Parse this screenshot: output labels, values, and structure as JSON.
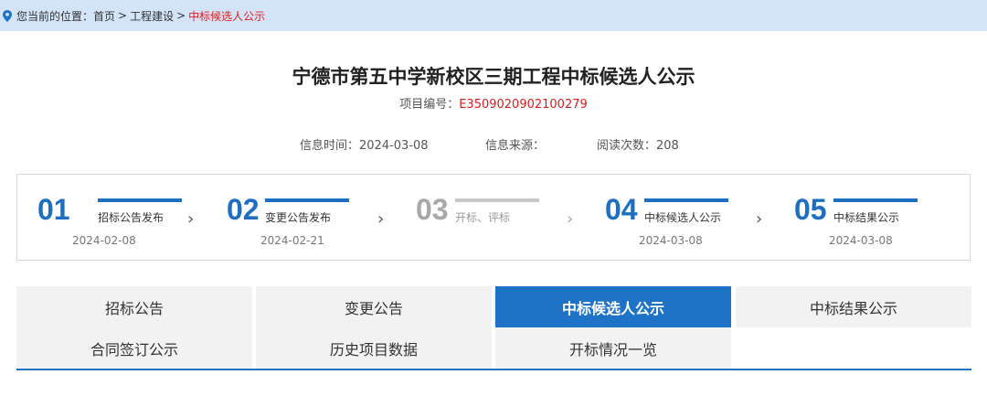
{
  "breadcrumb": {
    "prefix": "您当前的位置：",
    "items": [
      "首页",
      "工程建设"
    ],
    "separator": ">",
    "current": "中标候选人公示"
  },
  "title": "宁德市第五中学新校区三期工程中标候选人公示",
  "project_code": {
    "label": "项目编号：",
    "value": "E3509020902100279"
  },
  "meta": {
    "time": "信息时间：2024-03-08",
    "source": "信息来源：",
    "views": "阅读次数：208"
  },
  "steps": [
    {
      "num": "01",
      "label": "招标公告发布",
      "date": "2024-02-08",
      "state": "done"
    },
    {
      "num": "02",
      "label": "变更公告发布",
      "date": "2024-02-21",
      "state": "done"
    },
    {
      "num": "03",
      "label": "开标、评标",
      "date": "",
      "state": "inactive"
    },
    {
      "num": "04",
      "label": "中标候选人公示",
      "date": "2024-03-08",
      "state": "done"
    },
    {
      "num": "05",
      "label": "中标结果公示",
      "date": "2024-03-08",
      "state": "done"
    }
  ],
  "chevron": "›",
  "tabs": [
    {
      "label": "招标公告",
      "active": false
    },
    {
      "label": "变更公告",
      "active": false
    },
    {
      "label": "中标候选人公示",
      "active": true
    },
    {
      "label": "中标结果公示",
      "active": false
    },
    {
      "label": "合同签订公示",
      "active": false
    },
    {
      "label": "历史项目数据",
      "active": false
    },
    {
      "label": "开标情况一览",
      "active": false
    }
  ],
  "colors": {
    "accent": "#1f73c6",
    "highlight": "#d71e1e",
    "crumb_bg": "#d3e4f8"
  }
}
